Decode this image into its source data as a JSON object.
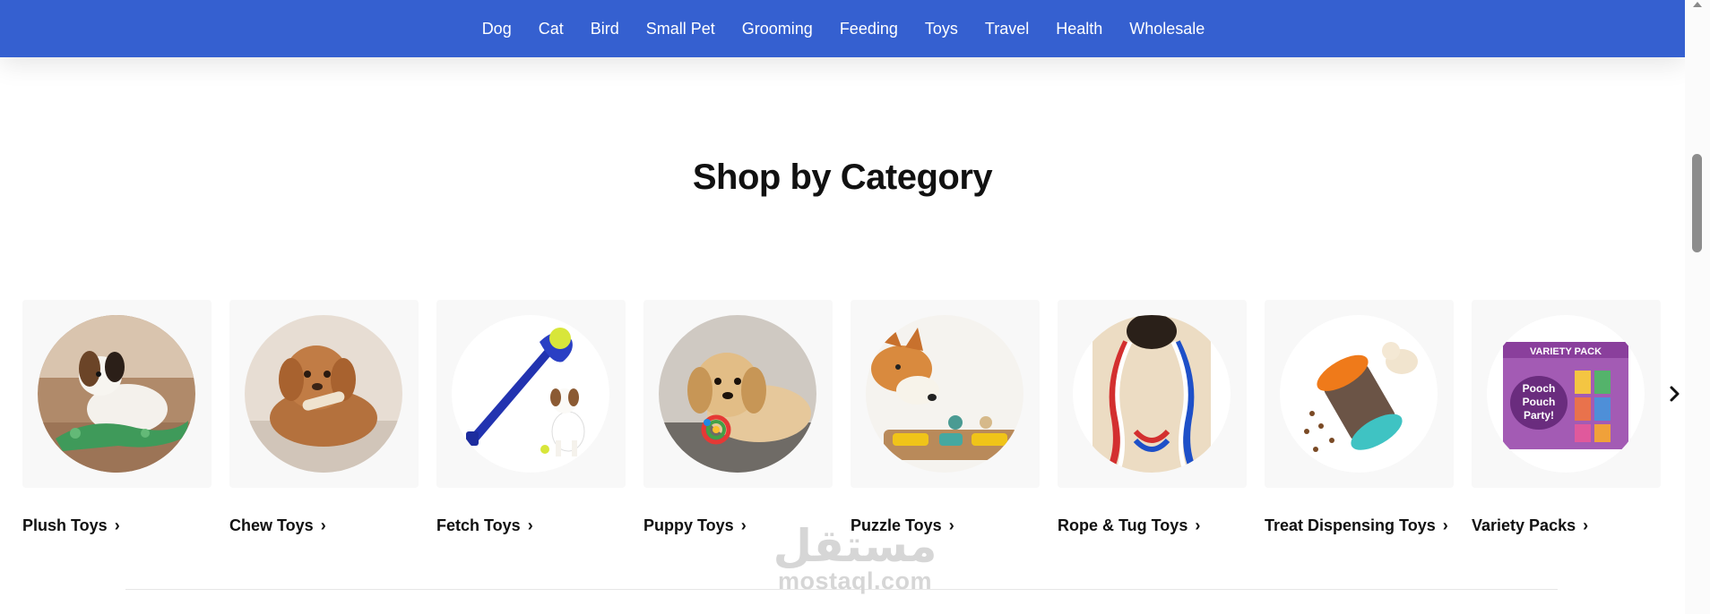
{
  "nav": {
    "items": [
      {
        "label": "Dog"
      },
      {
        "label": "Cat"
      },
      {
        "label": "Bird"
      },
      {
        "label": "Small Pet"
      },
      {
        "label": "Grooming"
      },
      {
        "label": "Feeding"
      },
      {
        "label": "Toys"
      },
      {
        "label": "Travel"
      },
      {
        "label": "Health"
      },
      {
        "label": "Wholesale"
      }
    ]
  },
  "section": {
    "title": "Shop by Category"
  },
  "categories": [
    {
      "label": "Plush Toys"
    },
    {
      "label": "Chew Toys"
    },
    {
      "label": "Fetch Toys"
    },
    {
      "label": "Puppy Toys"
    },
    {
      "label": "Puzzle Toys"
    },
    {
      "label": "Rope & Tug Toys"
    },
    {
      "label": "Treat Dispensing Toys"
    },
    {
      "label": "Variety Packs"
    }
  ],
  "variety_pack_box": {
    "heading": "VARIETY PACK",
    "slogan_line1": "Pooch",
    "slogan_line2": "Pouch",
    "slogan_line3": "Party!"
  },
  "watermark": {
    "arabic": "مستقل",
    "latin": "mostaql.com"
  },
  "colors": {
    "nav_background": "#3560d0",
    "card_background": "#f8f8f8"
  }
}
